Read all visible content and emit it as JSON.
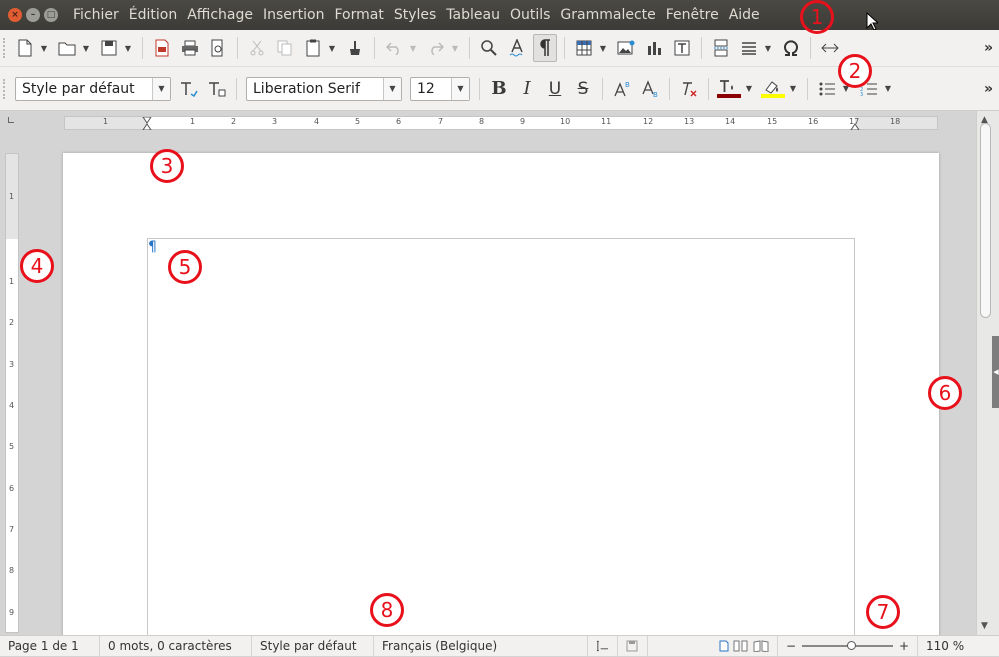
{
  "window": {
    "close_glyph": "×",
    "min_glyph": "–",
    "max_glyph": "□"
  },
  "menu": [
    "Fichier",
    "Édition",
    "Affichage",
    "Insertion",
    "Format",
    "Styles",
    "Tableau",
    "Outils",
    "Grammalecte",
    "Fenêtre",
    "Aide"
  ],
  "toolbar_standard": {
    "more": "»"
  },
  "toolbar_format": {
    "paragraph_style": "Style par défaut",
    "font_name": "Liberation Serif",
    "font_size": "12",
    "bold": "B",
    "italic": "I",
    "underline": "U",
    "strike": "S",
    "superscript": "Aᴮ",
    "subscript": "Aᴮ",
    "clear": "T",
    "more": "»"
  },
  "ruler": {
    "labels": [
      "1",
      "1",
      "2",
      "3",
      "4",
      "5",
      "6",
      "7",
      "8",
      "9",
      "10",
      "11",
      "12",
      "13",
      "14",
      "15",
      "16",
      "17",
      "18"
    ]
  },
  "vruler": {
    "labels": [
      "1",
      "1",
      "2",
      "3",
      "4",
      "5",
      "6",
      "7",
      "8",
      "9"
    ]
  },
  "document": {
    "paragraph_mark": "¶"
  },
  "statusbar": {
    "page": "Page 1 de 1",
    "words": "0 mots, 0 caractères",
    "style": "Style par défaut",
    "language": "Français (Belgique)",
    "zoom_minus": "−",
    "zoom_plus": "+",
    "zoom": "110 %"
  },
  "annotations": [
    "1",
    "2",
    "3",
    "4",
    "5",
    "6",
    "7",
    "8"
  ],
  "colors": {
    "annotation": "#e8111b",
    "menubar": "#3c3b37",
    "font_color_bar": "#8b0000",
    "highlight_bar": "#ffff00",
    "pilcrow": "#2a76c6"
  }
}
